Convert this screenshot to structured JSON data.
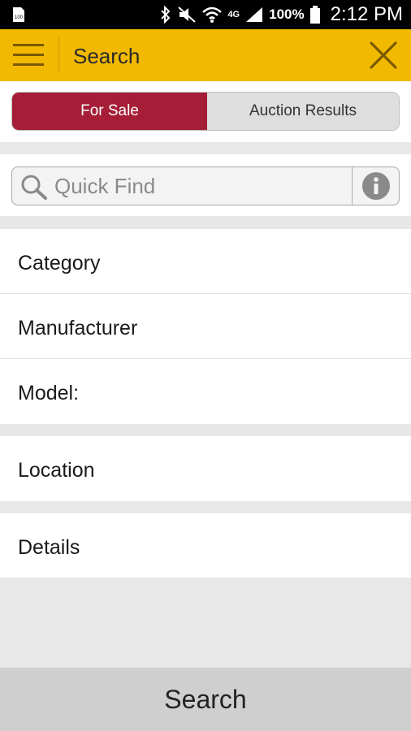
{
  "status_bar": {
    "battery_percent": "100%",
    "network": "4G",
    "time": "2:12 PM",
    "icons": [
      "sd-card-icon",
      "bluetooth-icon",
      "mute-icon",
      "wifi-icon",
      "signal-icon",
      "battery-icon"
    ]
  },
  "app_bar": {
    "title": "Search",
    "color": "#f1b900"
  },
  "segmented_control": {
    "options": [
      "For Sale",
      "Auction Results"
    ],
    "selected": "For Sale",
    "active_color": "#a51d36"
  },
  "quick_find": {
    "placeholder": "Quick Find",
    "value": ""
  },
  "filters": {
    "category": "Category",
    "manufacturer": "Manufacturer",
    "model": "Model:",
    "location": "Location",
    "details": "Details"
  },
  "footer": {
    "search_label": "Search"
  }
}
